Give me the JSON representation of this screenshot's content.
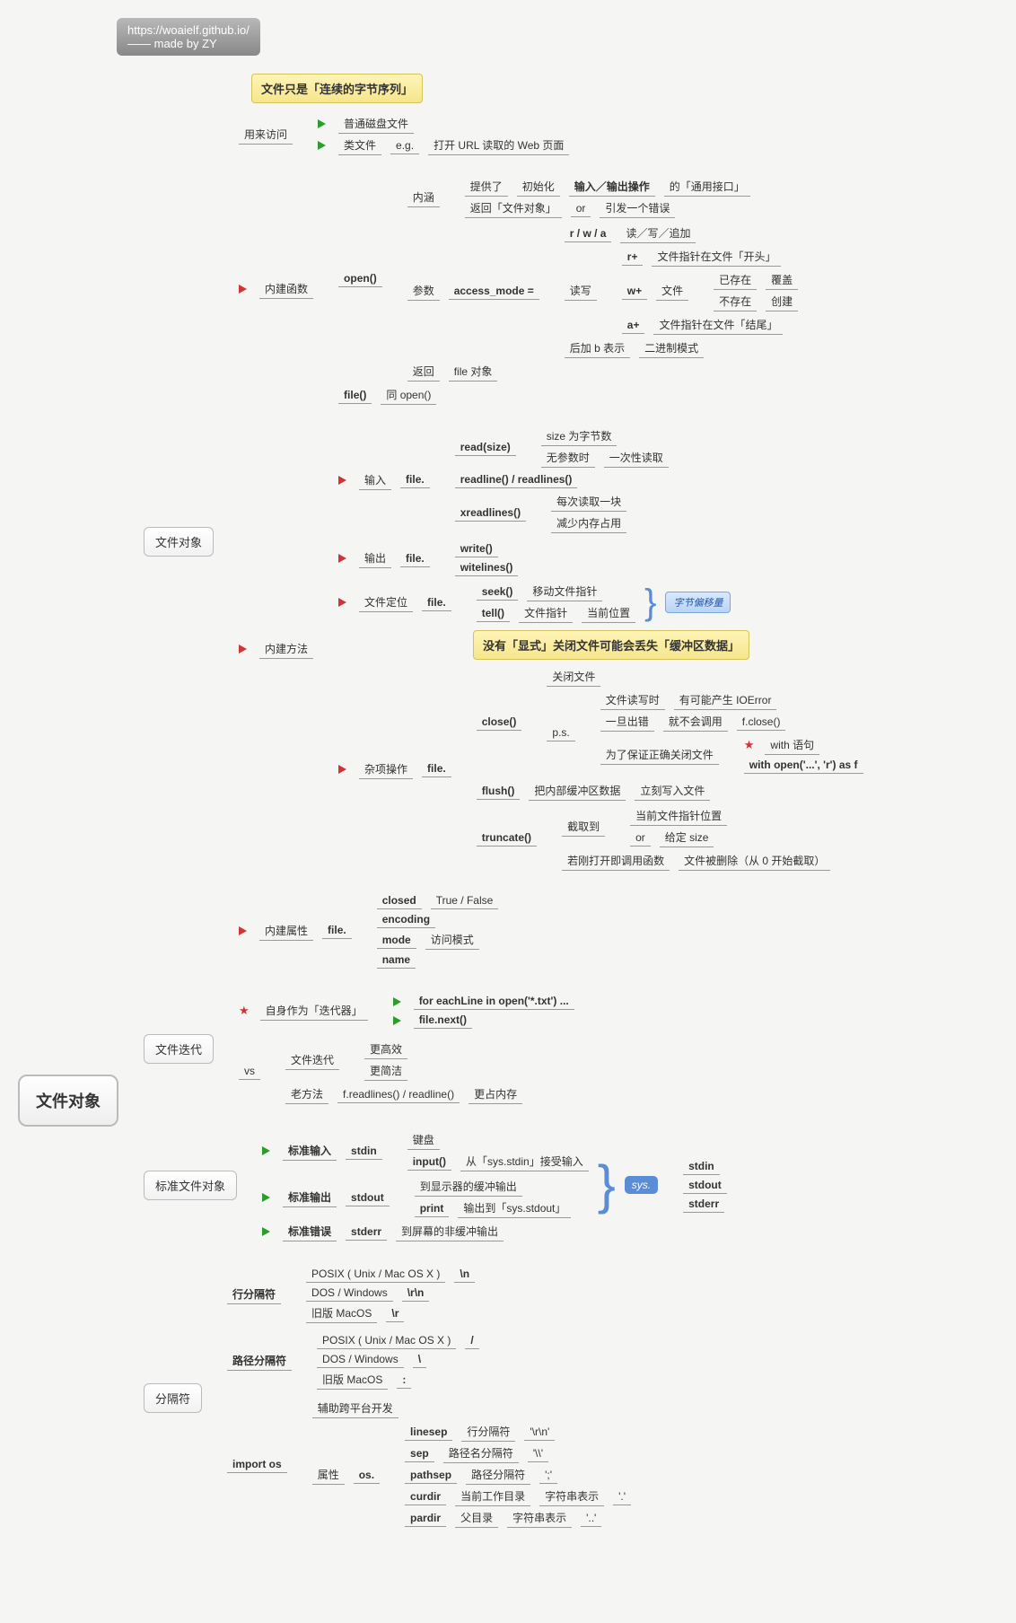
{
  "header": {
    "url": "https://woaielf.github.io/",
    "credit": "—— made by ZY"
  },
  "root": "文件对象",
  "callouts": {
    "c1": "文件只是「连续的字节序列」",
    "c2": "没有「显式」关闭文件可能会丢失「缓冲区数据」",
    "c3": "字节偏移量"
  },
  "b1": {
    "label": "文件对象",
    "access": {
      "lbl": "用来访问",
      "a": "普通磁盘文件",
      "b": "类文件",
      "eg": "e.g.",
      "egtxt": "打开 URL 读取的 Web 页面"
    },
    "builtin_fn": {
      "lbl": "内建函数",
      "open": "open()",
      "connotation": {
        "lbl": "内涵",
        "p1": "提供了",
        "p2": "初始化",
        "p3": "输入／输出操作",
        "p4": "的「通用接口」",
        "r1": "返回「文件对象」",
        "r2": "or",
        "r3": "引发一个错误"
      },
      "params": {
        "lbl": "参数",
        "am": "access_mode =",
        "rwa": "r / w / a",
        "rwa_desc": "读／写／追加",
        "mid": "读写",
        "rp": "r+",
        "rp_desc": "文件指针在文件「开头」",
        "wp": "w+",
        "wp_file": "文件",
        "wp_ex": "已存在",
        "wp_ov": "覆盖",
        "wp_nex": "不存在",
        "wp_cr": "创建",
        "ap": "a+",
        "ap_desc": "文件指针在文件「结尾」",
        "bsuffix": "后加 b 表示",
        "bdesc": "二进制模式"
      },
      "ret": {
        "lbl": "返回",
        "v": "file 对象"
      },
      "file_fn": "file()",
      "file_same": "同 open()"
    },
    "builtin_method": {
      "lbl": "内建方法",
      "input": {
        "lbl": "输入",
        "pre": "file.",
        "read": "read(size)",
        "size": "size 为字节数",
        "noarg": "无参数时",
        "once": "一次性读取",
        "readline": "readline() / readlines()",
        "xread": "xreadlines()",
        "x1": "每次读取一块",
        "x2": "减少内存占用"
      },
      "output": {
        "lbl": "输出",
        "pre": "file.",
        "write": "write()",
        "writelines": "witelines()"
      },
      "seek": {
        "lbl": "文件定位",
        "pre": "file.",
        "seek": "seek()",
        "seekdesc": "移动文件指针",
        "tell": "tell()",
        "t1": "文件指针",
        "t2": "当前位置"
      },
      "misc": {
        "lbl": "杂项操作",
        "pre": "file.",
        "close": "close()",
        "close_desc": "关闭文件",
        "ps": "p.s.",
        "p1": "文件读写时",
        "p2": "有可能产生 IOError",
        "p3": "一旦出错",
        "p4": "就不会调用",
        "p5": "f.close()",
        "ensure": "为了保证正确关闭文件",
        "with": "with 语句",
        "withcode": "with open('...', 'r') as f",
        "flush": "flush()",
        "f1": "把内部缓冲区数据",
        "f2": "立刻写入文件",
        "trunc": "truncate()",
        "t_cut": "截取到",
        "t_cur": "当前文件指针位置",
        "t_or": "or",
        "t_size": "给定 size",
        "t_imm": "若刚打开即调用函数",
        "t_del": "文件被删除（从 0 开始截取）"
      }
    },
    "builtin_attr": {
      "lbl": "内建属性",
      "pre": "file.",
      "closed": "closed",
      "closed_v": "True / False",
      "encoding": "encoding",
      "mode": "mode",
      "mode_v": "访问模式",
      "name": "name"
    }
  },
  "b2": {
    "label": "文件迭代",
    "self": {
      "lbl": "自身作为「迭代器」",
      "a": "for eachLine in open('*.txt') ...",
      "b": "file.next()"
    },
    "vs": {
      "lbl": "vs",
      "it": "文件迭代",
      "e1": "更高效",
      "e2": "更简洁",
      "old": "老方法",
      "old_m": "f.readlines() / readline()",
      "old_c": "更占内存"
    }
  },
  "b3": {
    "label": "标准文件对象",
    "in": {
      "lbl": "标准输入",
      "t": "stdin",
      "kb": "键盘",
      "inp": "input()",
      "from": "从「sys.stdin」接受输入"
    },
    "out": {
      "lbl": "标准输出",
      "t": "stdout",
      "buf": "到显示器的缓冲输出",
      "pr": "print",
      "to": "输出到「sys.stdout」"
    },
    "err": {
      "lbl": "标准错误",
      "t": "stderr",
      "unbuf": "到屏幕的非缓冲输出"
    },
    "sys": {
      "lbl": "sys.",
      "a": "stdin",
      "b": "stdout",
      "c": "stderr"
    }
  },
  "b4": {
    "label": "分隔符",
    "line": {
      "lbl": "行分隔符",
      "posix": "POSIX ( Unix / Mac OS X )",
      "posix_v": "\\n",
      "dos": "DOS / Windows",
      "dos_v": "\\r\\n",
      "mac": "旧版 MacOS",
      "mac_v": "\\r"
    },
    "path": {
      "lbl": "路径分隔符",
      "posix": "POSIX ( Unix / Mac OS X )",
      "posix_v": "/",
      "dos": "DOS / Windows",
      "dos_v": "\\",
      "mac": "旧版 MacOS",
      "mac_v": ":"
    },
    "os": {
      "lbl": "import os",
      "aid": "辅助跨平台开发",
      "attr": "属性",
      "pre": "os.",
      "linesep": "linesep",
      "linesep_d": "行分隔符",
      "linesep_v": "'\\r\\n'",
      "sep": "sep",
      "sep_d": "路径名分隔符",
      "sep_v": "'\\\\'",
      "pathsep": "pathsep",
      "pathsep_d": "路径分隔符",
      "pathsep_v": "';'",
      "curdir": "curdir",
      "curdir_d": "当前工作目录",
      "as_str": "字符串表示",
      "curdir_v": "'.'",
      "pardir": "pardir",
      "pardir_d": "父目录",
      "pardir_v": "'..'"
    }
  }
}
